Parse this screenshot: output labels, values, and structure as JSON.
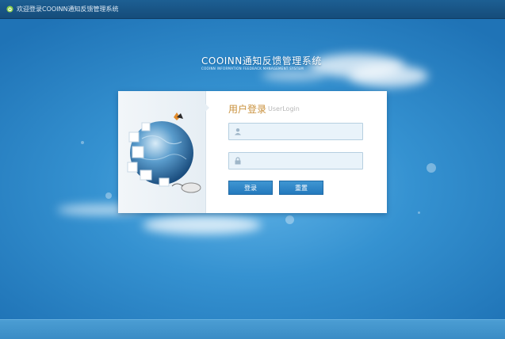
{
  "topbar": {
    "welcome_text": "欢迎登录COOINN通知反馈管理系统",
    "icon": "home-icon"
  },
  "brand": {
    "title": "COOINN通知反馈管理系统",
    "subtitle": "COOINN INFORMATION FEEDBACK MANAGEMENT SYSTEM"
  },
  "login": {
    "title": "用户登录",
    "subtitle": "UserLogin",
    "username": {
      "value": "",
      "placeholder": "",
      "icon": "user-icon"
    },
    "password": {
      "value": "",
      "placeholder": "",
      "icon": "lock-icon"
    },
    "login_button": "登录",
    "reset_button": "重置"
  },
  "colors": {
    "accent": "#2479bd",
    "title_gold": "#c9913d",
    "field_bg": "#e9f3fa"
  }
}
